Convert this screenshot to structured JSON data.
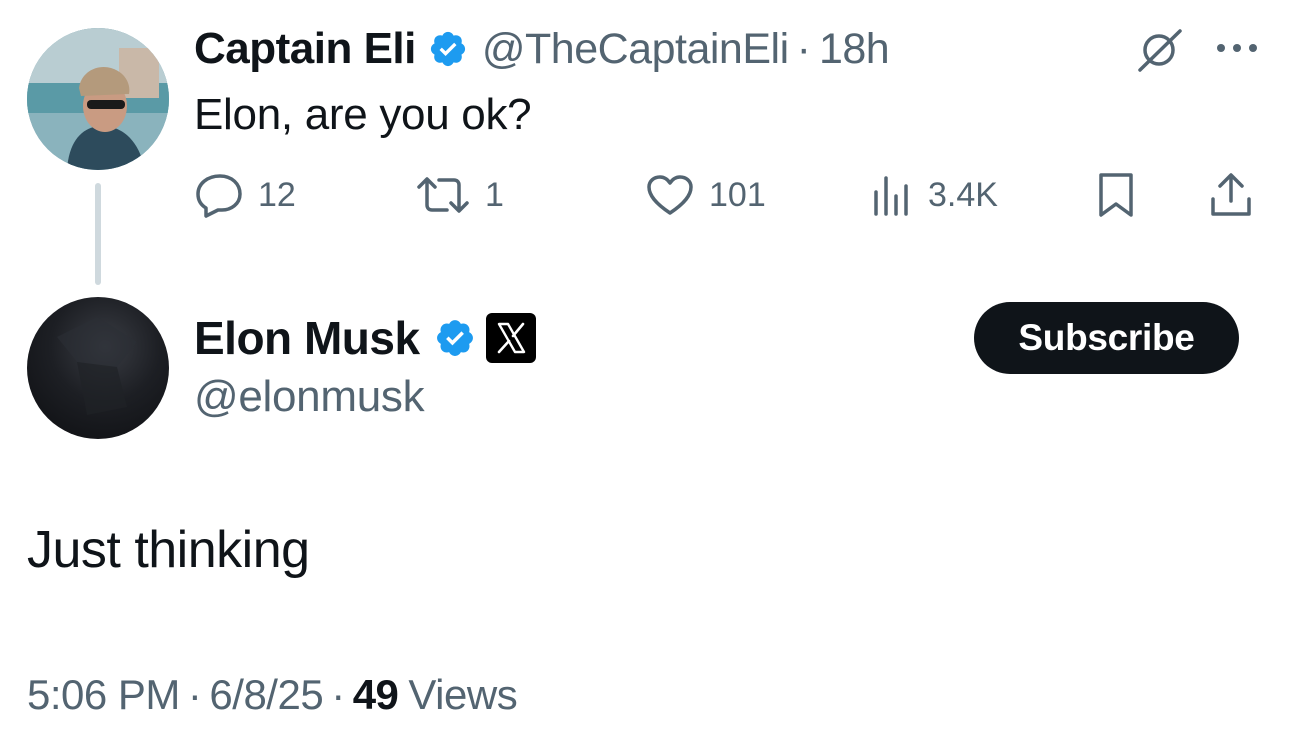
{
  "parent_tweet": {
    "display_name": "Captain Eli",
    "handle": "@TheCaptainEli",
    "separator": "·",
    "age": "18h",
    "text": "Elon, are you ok?",
    "icons": {
      "verified": "verified-badge-icon",
      "grok": "grok-icon",
      "more": "more-icon"
    },
    "actions": {
      "replies": "12",
      "reposts": "1",
      "likes": "101",
      "views": "3.4K"
    }
  },
  "main_tweet": {
    "display_name": "Elon Musk",
    "handle": "@elonmusk",
    "subscribe_label": "Subscribe",
    "text": "Just thinking",
    "time": "5:06 PM",
    "date": "6/8/25",
    "separator": "·",
    "views_count": "49",
    "views_label": "Views",
    "icons": {
      "verified": "verified-badge-icon",
      "affiliation": "x-logo-icon"
    }
  },
  "colors": {
    "text_primary": "#0f1419",
    "text_secondary": "#536471",
    "verified_blue": "#1d9bf0",
    "thread_line": "#cfd9de",
    "button_bg": "#0f1419"
  }
}
